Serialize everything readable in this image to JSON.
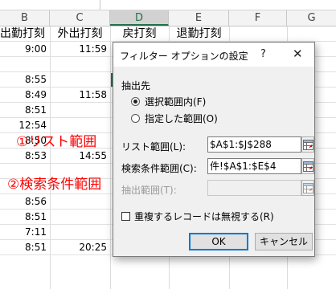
{
  "sheet": {
    "columns": [
      "B",
      "C",
      "D",
      "E",
      "F",
      "G"
    ],
    "selected_column": "D",
    "headers": [
      "出勤打刻",
      "外出打刻",
      "戻打刻",
      "退勤打刻"
    ],
    "rows": [
      {
        "b": "9:00",
        "c": "11:59"
      },
      {
        "b": "",
        "c": ""
      },
      {
        "b": "8:55",
        "c": ""
      },
      {
        "b": "8:49",
        "c": "11:58"
      },
      {
        "b": "8:51",
        "c": ""
      },
      {
        "b": "12:54",
        "c": ""
      },
      {
        "b": "8:50",
        "c": ""
      },
      {
        "b": "8:53",
        "c": "14:55"
      },
      {
        "b": "",
        "c": ""
      },
      {
        "b": "",
        "c": ""
      },
      {
        "b": "8:56",
        "c": ""
      },
      {
        "b": "8:51",
        "c": ""
      },
      {
        "b": "7:11",
        "c": ""
      },
      {
        "b": "8:51",
        "c": "20:25"
      }
    ],
    "annotation_list_range": "①リスト範囲",
    "annotation_criteria_range": "②検索条件範囲",
    "annotation_color": "#ff0000"
  },
  "dialog": {
    "title": "フィルター オプションの設定",
    "help": "?",
    "close": "✕",
    "group_label": "抽出先",
    "radio_in_place": "選択範囲内(F)",
    "radio_copy_to": "指定した範囲(O)",
    "list_range_label": "リスト範囲(L):",
    "list_range_value": "$A$1:$J$288",
    "criteria_range_label": "検索条件範囲(C):",
    "criteria_range_value": "件!$A$1:$E$4",
    "extract_to_label": "抽出範囲(T):",
    "extract_to_value": "",
    "unique_records_label": "重複するレコードは無視する(R)",
    "ok_label": "OK",
    "cancel_label": "キャンセル",
    "accent_color": "#0078d7"
  }
}
